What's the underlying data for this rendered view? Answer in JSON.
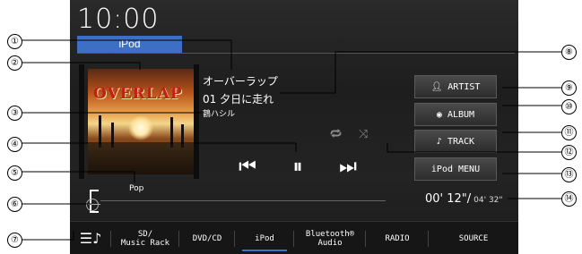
{
  "status": {
    "clock": "10:00"
  },
  "source_tab": "iPod",
  "now_playing": {
    "album_art_text": "OVERLAP",
    "album": "オーバーラップ",
    "track": "01 夕日に走れ",
    "artist": "鶴ハシル",
    "genre": "Pop",
    "elapsed": "00' 12\"/",
    "total": "04' 32\""
  },
  "transport": {
    "prev_icon": "skip-previous-icon",
    "pause_icon": "pause-icon",
    "next_icon": "skip-next-icon"
  },
  "modes": {
    "repeat_icon": "repeat-icon",
    "shuffle_icon": "shuffle-icon"
  },
  "side_menu": [
    {
      "label": "ARTIST",
      "icon": "person-icon"
    },
    {
      "label": "ALBUM",
      "icon": "disc-icon"
    },
    {
      "label": "TRACK",
      "icon": "music-note-icon"
    },
    {
      "label": "iPod MENU",
      "icon": ""
    }
  ],
  "bottom_tabs": [
    {
      "label": "",
      "icon": "settings-music-icon"
    },
    {
      "label": "SD/\nMusic Rack"
    },
    {
      "label": "DVD/CD"
    },
    {
      "label": "iPod",
      "active": true
    },
    {
      "label": "Bluetooth®\nAudio"
    },
    {
      "label": "RADIO"
    },
    {
      "label": "SOURCE"
    }
  ],
  "callouts": [
    "①",
    "②",
    "③",
    "④",
    "⑤",
    "⑥",
    "⑦",
    "⑧",
    "⑨",
    "⑩",
    "⑪",
    "⑫",
    "⑬",
    "⑭"
  ],
  "colors": {
    "accent": "#3d6fc4",
    "background": "#222222"
  }
}
